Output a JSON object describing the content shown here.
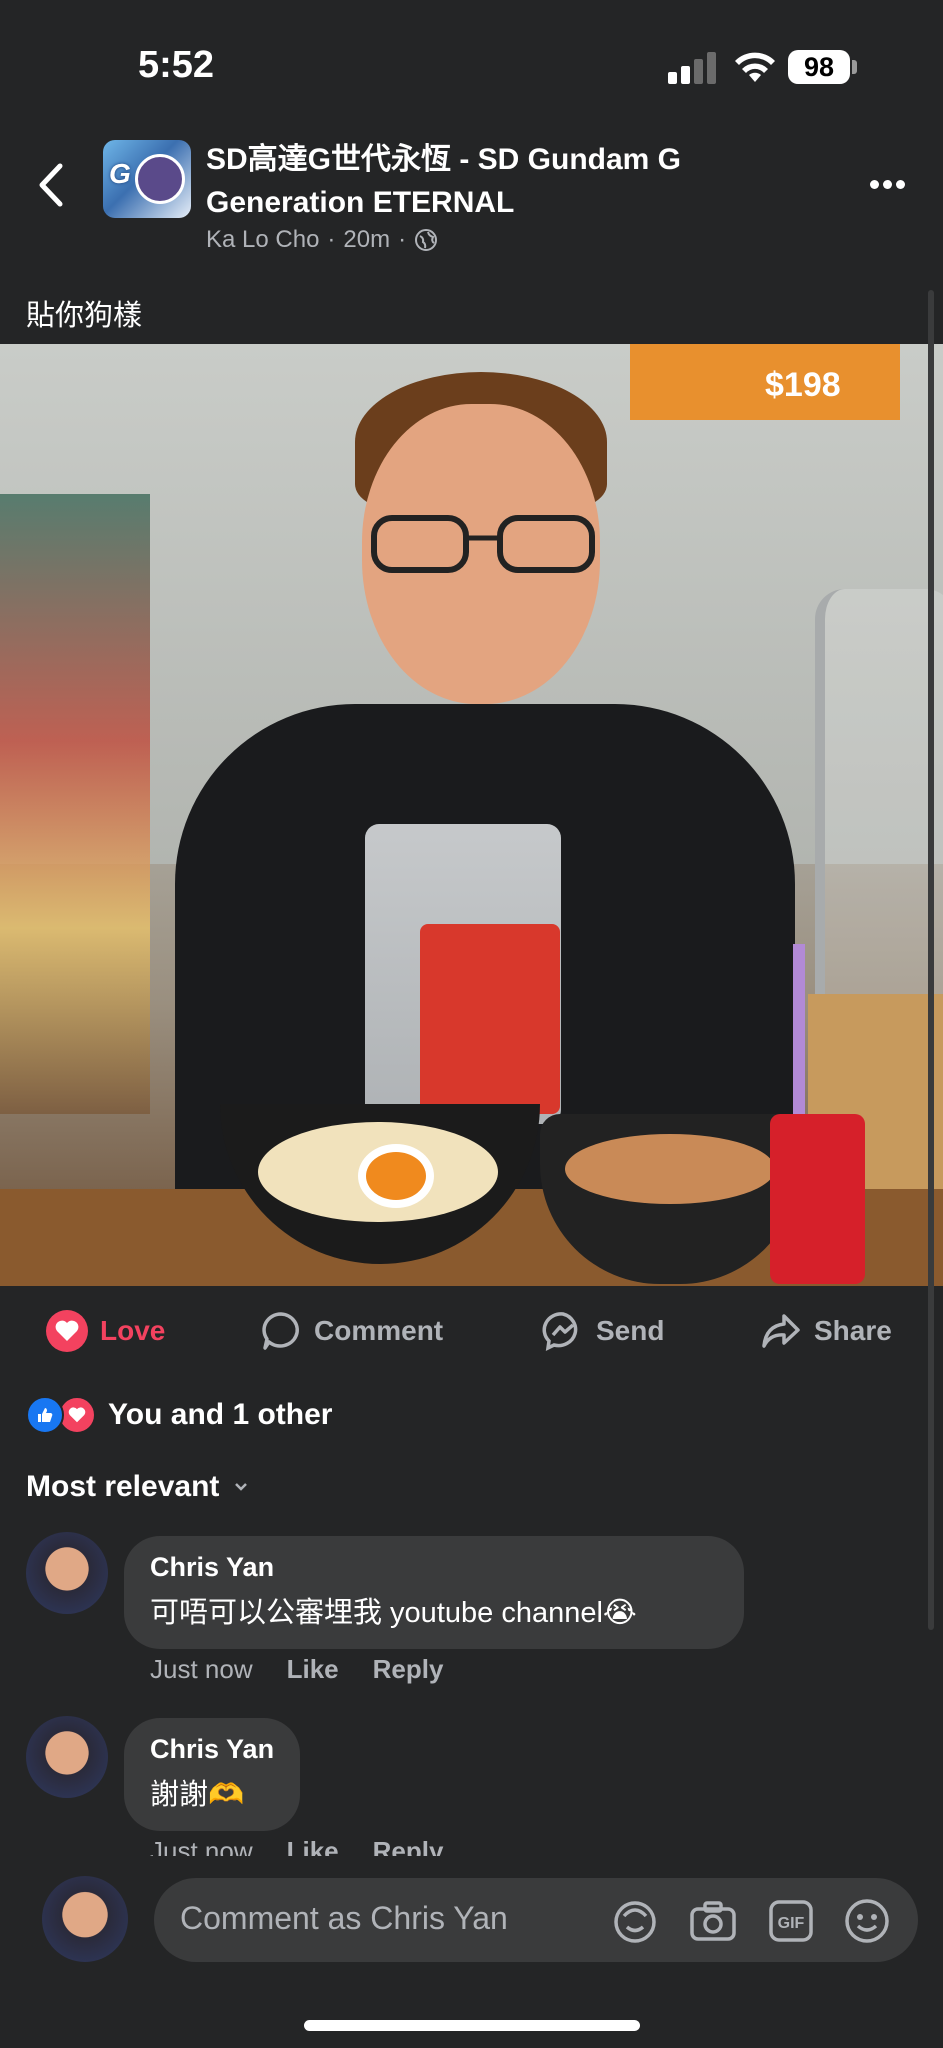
{
  "status_bar": {
    "time": "5:52",
    "battery": "98"
  },
  "header": {
    "title": "SD高達G世代永恆 - SD Gundam G Generation ETERNAL",
    "author": "Ka Lo Cho",
    "age": "20m",
    "separator": "·"
  },
  "post": {
    "caption": "貼你狗樣"
  },
  "photo": {
    "price_sign": "$198"
  },
  "actions": {
    "love": "Love",
    "comment": "Comment",
    "send": "Send",
    "share": "Share"
  },
  "reactions": {
    "summary": "You and 1 other"
  },
  "sort": {
    "label": "Most relevant"
  },
  "comments": [
    {
      "name": "Chris Yan",
      "text": "可唔可以公審埋我 youtube channel😭",
      "time": "Just now",
      "like": "Like",
      "reply": "Reply"
    },
    {
      "name": "Chris Yan",
      "text": "謝謝🫶",
      "time": "Just now",
      "like": "Like",
      "reply": "Reply"
    }
  ],
  "composer": {
    "placeholder": "Comment as Chris Yan"
  },
  "colors": {
    "background": "#242526",
    "love": "#f3425f",
    "like": "#1877f2",
    "bubble": "#3a3b3c"
  },
  "icons": [
    "back-chevron-icon",
    "more-dots-icon",
    "globe-icon",
    "love-icon",
    "comment-icon",
    "messenger-icon",
    "share-icon",
    "like-reaction-icon",
    "love-reaction-icon",
    "chevron-down-icon",
    "avatar-sticker-icon",
    "camera-icon",
    "gif-icon",
    "emoji-icon"
  ]
}
